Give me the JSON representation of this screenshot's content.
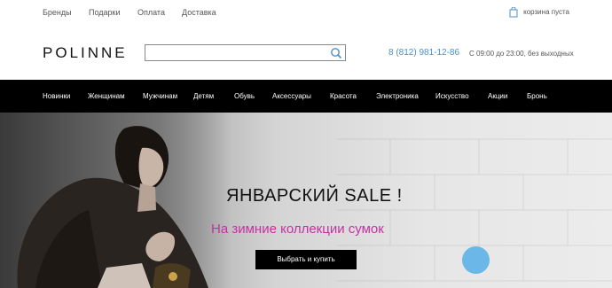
{
  "top_links": [
    "Бренды",
    "Подарки",
    "Оплата",
    "Доставка"
  ],
  "cart": {
    "text": "корзина пуста",
    "icon": "bag-icon"
  },
  "logo": "POLINNE",
  "search": {
    "placeholder": "",
    "icon": "search-icon"
  },
  "phone": "8 (812) 981-12-86",
  "hours": "С 09:00 до 23:00, без выходных",
  "nav": [
    "Новинки",
    "Женщинам",
    "Мужчинам",
    "Детям",
    "Обувь",
    "Аксессуары",
    "Красота",
    "Электроника",
    "Искусство",
    "Акции",
    "Бронь"
  ],
  "hero": {
    "title": "ЯНВАРСКИЙ SALE !",
    "subtitle": "На зимние коллекции сумок",
    "button": "Выбрать и купить"
  },
  "colors": {
    "accent": "#4a90c8",
    "subtitle": "#c531a3",
    "nav_bg": "#000000",
    "chat": "#6bb7e8"
  }
}
